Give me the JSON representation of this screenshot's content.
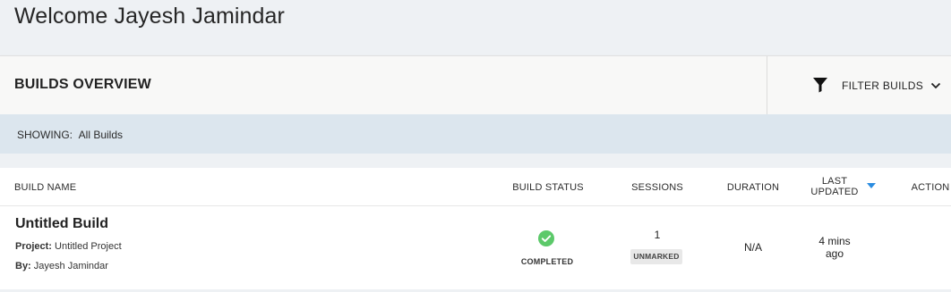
{
  "header": {
    "welcome": "Welcome Jayesh Jamindar"
  },
  "overview": {
    "title": "BUILDS OVERVIEW",
    "filter_label": "FILTER BUILDS",
    "filter_icon": "funnel-icon",
    "chevron_icon": "chevron-down-icon"
  },
  "showing": {
    "label": "SHOWING:",
    "value": "All Builds"
  },
  "table": {
    "columns": {
      "build_name": "BUILD NAME",
      "build_status": "BUILD STATUS",
      "sessions": "SESSIONS",
      "duration": "DURATION",
      "last_updated_line1": "LAST",
      "last_updated_line2": "UPDATED",
      "action": "ACTION"
    },
    "sort_icon": "caret-down-icon",
    "rows": [
      {
        "name": "Untitled Build",
        "project_label": "Project:",
        "project": "Untitled Project",
        "by_label": "By:",
        "by": "Jayesh Jamindar",
        "status": "COMPLETED",
        "status_icon": "check-circle-icon",
        "status_color": "#5cc96a",
        "sessions": "1",
        "session_badge": "UNMARKED",
        "duration": "N/A",
        "updated_line1": "4 mins",
        "updated_line2": "ago"
      }
    ]
  }
}
